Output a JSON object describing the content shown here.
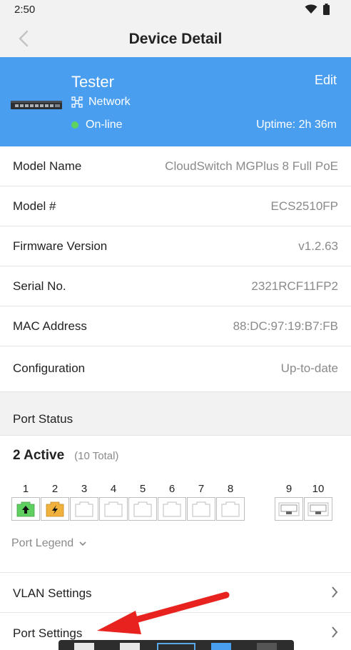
{
  "status_bar": {
    "time": "2:50",
    "icons": [
      "wifi-icon",
      "battery-icon"
    ]
  },
  "nav": {
    "title": "Device Detail",
    "back_icon": "chevron-left-icon"
  },
  "device": {
    "name": "Tester",
    "edit_label": "Edit",
    "type_label": "Network",
    "type_icon": "network-icon",
    "status_label": "On-line",
    "uptime": "Uptime: 2h 36m",
    "card_color": "#4a9eef",
    "online_color": "#5fd35f"
  },
  "info": [
    {
      "label": "Model Name",
      "value": "CloudSwitch MGPlus 8 Full PoE"
    },
    {
      "label": "Model #",
      "value": "ECS2510FP"
    },
    {
      "label": "Firmware Version",
      "value": "v1.2.63"
    },
    {
      "label": "Serial No.",
      "value": "2321RCF11FP2"
    },
    {
      "label": "MAC Address",
      "value": "88:DC:97:19:B7:FB"
    },
    {
      "label": "Configuration",
      "value": "Up-to-date"
    }
  ],
  "port_status": {
    "header": "Port Status",
    "active": "2 Active",
    "total": "(10 Total)",
    "ports": [
      {
        "number": "1",
        "state": "uplink",
        "color": "#5fcf5f"
      },
      {
        "number": "2",
        "state": "poe",
        "color": "#f0b23c"
      },
      {
        "number": "3",
        "state": "inactive"
      },
      {
        "number": "4",
        "state": "inactive"
      },
      {
        "number": "5",
        "state": "inactive"
      },
      {
        "number": "6",
        "state": "inactive"
      },
      {
        "number": "7",
        "state": "inactive"
      },
      {
        "number": "8",
        "state": "inactive"
      },
      {
        "number": "9",
        "state": "sfp-inactive"
      },
      {
        "number": "10",
        "state": "sfp-inactive"
      }
    ],
    "legend_label": "Port Legend"
  },
  "menu": [
    {
      "label": "VLAN Settings"
    },
    {
      "label": "Port Settings"
    }
  ],
  "annotation": {
    "arrow_color": "#e8231f"
  }
}
